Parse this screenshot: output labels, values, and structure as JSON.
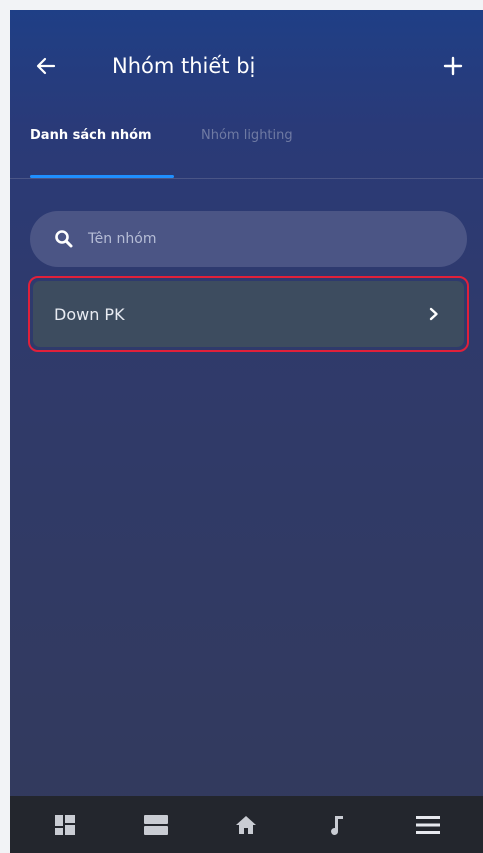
{
  "header": {
    "title": "Nhóm thiết bị",
    "back_icon": "arrow-left-icon",
    "add_icon": "plus-icon"
  },
  "tabs": [
    {
      "label": "Danh sách nhóm",
      "active": true
    },
    {
      "label": "Nhóm lighting",
      "active": false
    }
  ],
  "search": {
    "placeholder": "Tên nhóm",
    "icon": "search-icon"
  },
  "groups": [
    {
      "label": "Down PK",
      "icon": "chevron-right-icon"
    }
  ],
  "bottom_nav": [
    {
      "name": "dashboard",
      "icon": "grid-icon"
    },
    {
      "name": "rooms",
      "icon": "cards-icon"
    },
    {
      "name": "home",
      "icon": "home-icon"
    },
    {
      "name": "music",
      "icon": "music-note-icon"
    },
    {
      "name": "menu",
      "icon": "hamburger-icon"
    }
  ],
  "colors": {
    "accent": "#1f8fff",
    "highlight_border": "#e0203a",
    "nav_icon": "#c9ccd3"
  }
}
